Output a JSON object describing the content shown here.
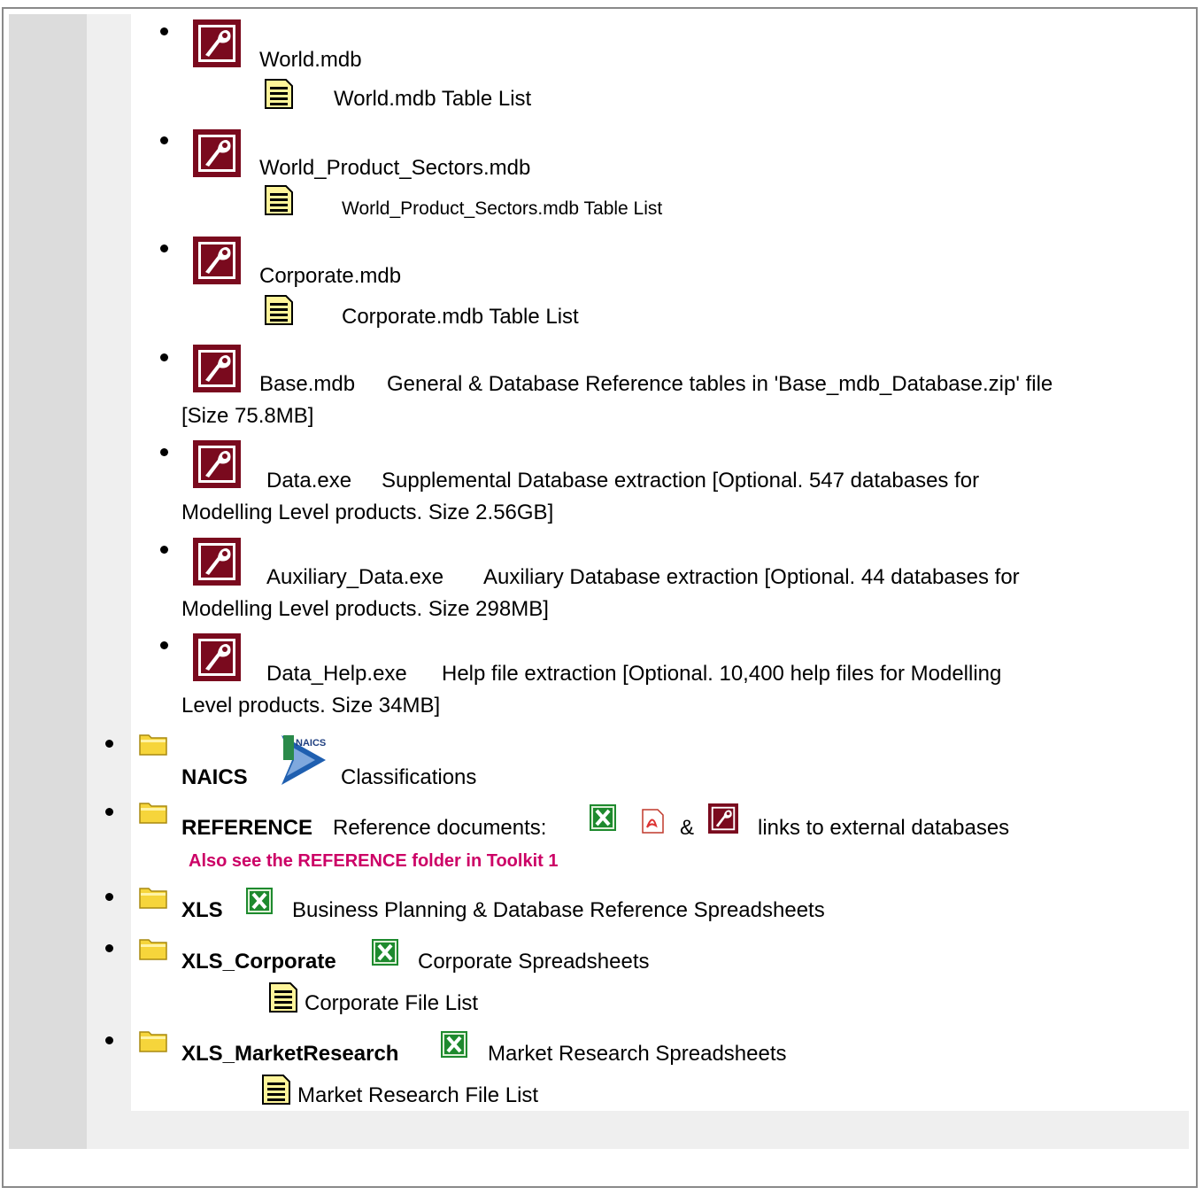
{
  "databases": [
    {
      "name": "World.mdb",
      "desc": "",
      "tablelist": "World.mdb Table List"
    },
    {
      "name": "World_Product_Sectors.mdb",
      "desc": "",
      "tablelist": "World_Product_Sectors.mdb Table List"
    },
    {
      "name": "Corporate.mdb",
      "desc": "",
      "tablelist": "Corporate.mdb Table List"
    },
    {
      "name": "Base.mdb",
      "desc": "General & Database Reference tables in 'Base_mdb_Database.zip' file",
      "desc2": "[Size 75.8MB]"
    },
    {
      "name": "Data.exe",
      "desc": "Supplemental Database extraction [Optional. 547 databases for",
      "desc2": "Modelling Level products. Size 2.56GB]"
    },
    {
      "name": "Auxiliary_Data.exe",
      "desc": "Auxiliary Database extraction [Optional. 44 databases for",
      "desc2": "Modelling Level products. Size 298MB]"
    },
    {
      "name": "Data_Help.exe",
      "desc": "Help file extraction [Optional. 10,400 help files for Modelling",
      "desc2": "Level products. Size 34MB]"
    }
  ],
  "folders": {
    "naics": {
      "name": "NAICS",
      "logo_text": "NAICS",
      "desc": "Classifications"
    },
    "reference": {
      "name": "REFERENCE",
      "desc": "Reference documents:",
      "amp": "&",
      "tail": "links to external databases",
      "note": "Also see the REFERENCE folder in Toolkit 1"
    },
    "xls": {
      "name": "XLS",
      "desc": "Business Planning & Database Reference Spreadsheets"
    },
    "xls_corporate": {
      "name": "XLS_Corporate",
      "desc": "Corporate Spreadsheets",
      "list": "Corporate File List"
    },
    "xls_market": {
      "name": "XLS_MarketResearch",
      "desc": "Market Research Spreadsheets",
      "list": "Market Research File List"
    }
  },
  "colors": {
    "access": "#7a0a1e",
    "folder": "#f6d53b",
    "xls": "#1e8a2e",
    "note": "#cc0066",
    "sidebar": "#dcdcdc"
  }
}
